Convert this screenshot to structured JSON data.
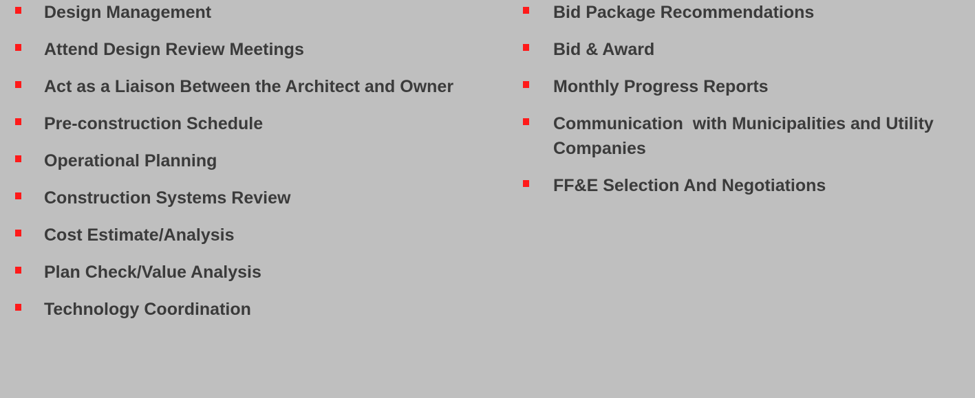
{
  "left_list": [
    {
      "label": "Design Management"
    },
    {
      "label": "Attend Design Review Meetings"
    },
    {
      "label": "Act as a Liaison Between the Architect and Owner"
    },
    {
      "label": "Pre-construction Schedule"
    },
    {
      "label": "Operational Planning"
    },
    {
      "label": "Construction Systems Review"
    },
    {
      "label": "Cost Estimate/Analysis"
    },
    {
      "label": "Plan Check/Value Analysis"
    },
    {
      "label": "Technology Coordination"
    }
  ],
  "right_list": [
    {
      "label": "Bid Package Recommendations"
    },
    {
      "label": "Bid & Award"
    },
    {
      "label": "Monthly Progress Reports"
    },
    {
      "label": "Communication  with Municipalities and Utility Companies"
    },
    {
      "label": "FF&E Selection And Negotiations"
    }
  ],
  "colors": {
    "background": "#bfbfbf",
    "text": "#3b3b3b",
    "bullet": "#ff1a1a"
  },
  "icons": {
    "bullet": "square-bullet-icon"
  }
}
